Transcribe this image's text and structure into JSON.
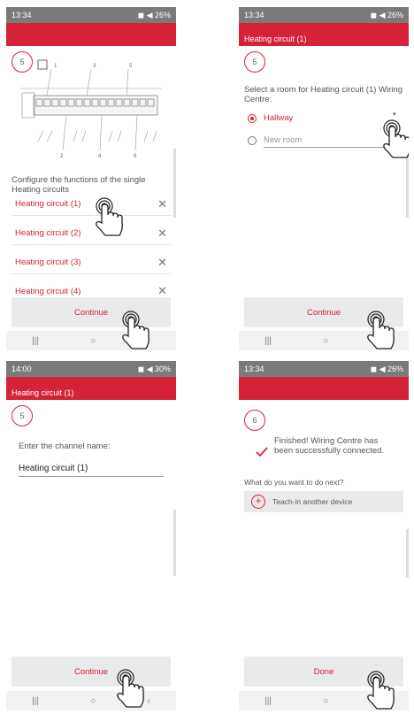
{
  "panels": [
    {
      "status_time": "13:34",
      "status_right": "◼ ◀ 26%",
      "appbar_title": "",
      "step": "5",
      "diagram_numbers": [
        "1",
        "3",
        "5",
        "2",
        "4",
        "6"
      ],
      "intro": "Configure the functions of the single Heating circuits",
      "circuits": [
        "Heating circuit (1)",
        "Heating circuit (2)",
        "Heating circuit (3)",
        "Heating circuit (4)"
      ],
      "footer_label": "Continue"
    },
    {
      "status_time": "13:34",
      "status_right": "◼ ◀ 26%",
      "appbar_title": "Heating circuit (1)",
      "step": "5",
      "intro": "Select a room for Heating circuit (1) Wiring Centre:",
      "option_selected": "Hallway",
      "option_placeholder": "New room",
      "footer_label": "Continue"
    },
    {
      "status_time": "14:00",
      "status_right": "◼ ◀ 30%",
      "appbar_title": "Heating circuit (1)",
      "step": "5",
      "prompt": "Enter the channel name:",
      "field_value": "Heating circuit (1)",
      "footer_label": "Continue"
    },
    {
      "status_time": "13:34",
      "status_right": "◼ ◀ 26%",
      "appbar_title": "",
      "step": "6",
      "finished": "Finished! Wiring Centre has been successfully connected.",
      "next_question": "What do you want to do next?",
      "teach_in": "Teach-in another device",
      "footer_label": "Done"
    }
  ],
  "navbar": {
    "recent": "|||",
    "home": "○"
  },
  "colors": {
    "accent": "#d62236",
    "statusbar": "#7a7a7a",
    "footer": "#e9eaeb"
  }
}
